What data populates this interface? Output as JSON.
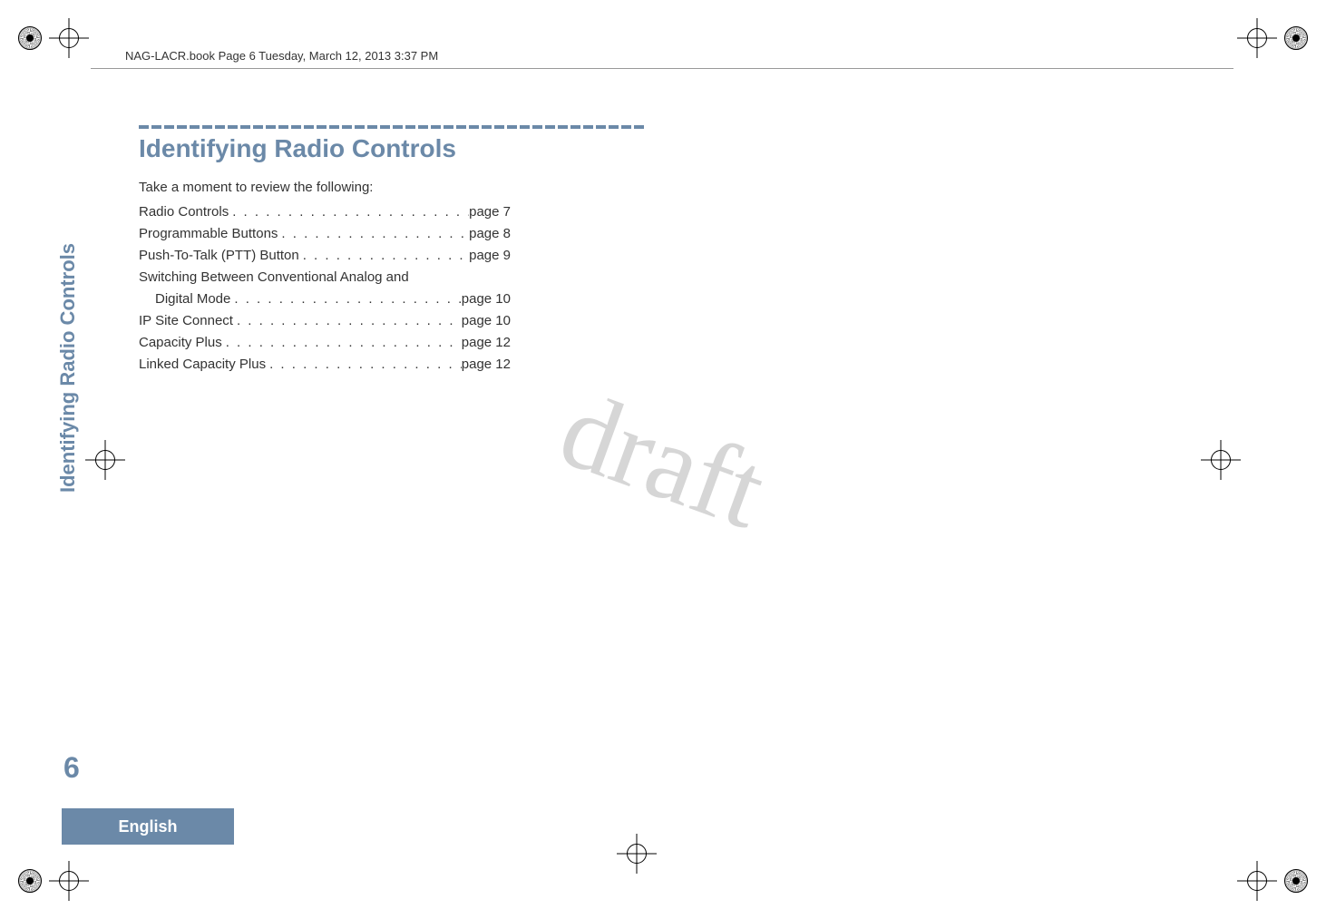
{
  "header": {
    "running_head": "NAG-LACR.book  Page 6  Tuesday, March 12, 2013  3:37 PM"
  },
  "section": {
    "title": "Identifying Radio Controls",
    "intro": "Take a moment to review the following:"
  },
  "toc": [
    {
      "label": "Radio Controls",
      "page": "page 7"
    },
    {
      "label": "Programmable Buttons",
      "page": "page 8"
    },
    {
      "label": "Push-To-Talk (PTT) Button",
      "page": "page 9"
    },
    {
      "label": "Switching Between Conventional Analog and",
      "page": ""
    },
    {
      "label": "Digital Mode",
      "page": "page 10",
      "indent": true
    },
    {
      "label": "IP Site Connect",
      "page": "page 10"
    },
    {
      "label": "Capacity Plus",
      "page": "page 12"
    },
    {
      "label": "Linked Capacity Plus",
      "page": "page 12"
    }
  ],
  "sidebar": {
    "vertical_text": "Identifying Radio Controls"
  },
  "footer": {
    "page_number": "6",
    "language_tab": "English"
  },
  "watermark": "draft"
}
